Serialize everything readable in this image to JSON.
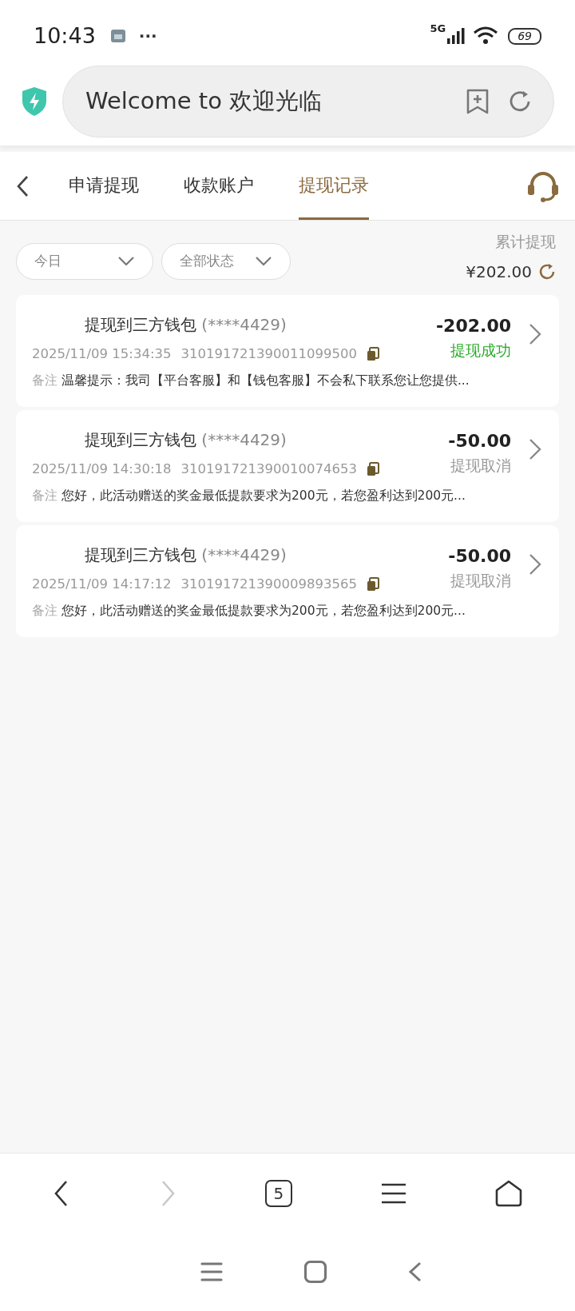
{
  "status_bar": {
    "time": "10:43",
    "more": "···",
    "network": "5G",
    "battery": "69"
  },
  "address_bar": {
    "text": "Welcome to 欢迎光临"
  },
  "tabs": [
    {
      "label": "申请提现",
      "selected": false
    },
    {
      "label": "收款账户",
      "selected": false
    },
    {
      "label": "提现记录",
      "selected": true
    }
  ],
  "filters": [
    {
      "label": "今日"
    },
    {
      "label": "全部状态"
    }
  ],
  "total": {
    "label": "累计提现",
    "amount": "¥202.00"
  },
  "records": [
    {
      "title": "提现到三方钱包",
      "account": "(****4429)",
      "amount": "-202.00",
      "status": "提现成功",
      "kind": "success",
      "time": "2025/11/09 15:34:35",
      "order_no": "310191721390011099500",
      "note_label": "备注",
      "note": "温馨提示：我司【平台客服】和【钱包客服】不会私下联系您让您提供..."
    },
    {
      "title": "提现到三方钱包",
      "account": "(****4429)",
      "amount": "-50.00",
      "status": "提现取消",
      "kind": "cancelled",
      "time": "2025/11/09 14:30:18",
      "order_no": "310191721390010074653",
      "note_label": "备注",
      "note": "您好，此活动赠送的奖金最低提款要求为200元，若您盈利达到200元..."
    },
    {
      "title": "提现到三方钱包",
      "account": "(****4429)",
      "amount": "-50.00",
      "status": "提现取消",
      "kind": "cancelled",
      "time": "2025/11/09 14:17:12",
      "order_no": "310191721390009893565",
      "note_label": "备注",
      "note": "您好，此活动赠送的奖金最低提款要求为200元，若您盈利达到200元..."
    }
  ],
  "browser_toolbar": [
    {
      "kind": "back",
      "disabled": false
    },
    {
      "kind": "forward",
      "disabled": true
    },
    {
      "kind": "tabs",
      "count": "5",
      "disabled": false
    },
    {
      "kind": "menu",
      "disabled": false
    },
    {
      "kind": "home",
      "disabled": false
    }
  ],
  "system_nav": [
    {
      "kind": "recents"
    },
    {
      "kind": "home"
    },
    {
      "kind": "back"
    }
  ]
}
